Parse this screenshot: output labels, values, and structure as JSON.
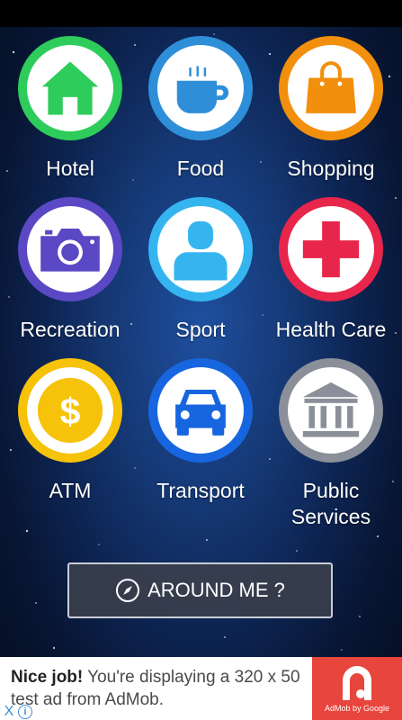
{
  "categories": [
    {
      "label": "Hotel",
      "color": "#2ecc5a",
      "icon": "house-icon"
    },
    {
      "label": "Food",
      "color": "#2e8fd8",
      "icon": "coffee-cup-icon"
    },
    {
      "label": "Shopping",
      "color": "#f28f0c",
      "icon": "shopping-bag-icon"
    },
    {
      "label": "Recreation",
      "color": "#5a48c4",
      "icon": "camera-icon"
    },
    {
      "label": "Sport",
      "color": "#35b5ef",
      "icon": "person-icon"
    },
    {
      "label": "Health Care",
      "color": "#e8254a",
      "icon": "medical-cross-icon"
    },
    {
      "label": "ATM",
      "color": "#f6c20a",
      "icon": "dollar-coin-icon"
    },
    {
      "label": "Transport",
      "color": "#1766e0",
      "icon": "car-icon"
    },
    {
      "label": "Public\nServices",
      "color": "#8a8f99",
      "icon": "bank-building-icon"
    }
  ],
  "around_button": {
    "label": "AROUND ME ?",
    "icon": "compass-icon"
  },
  "ad": {
    "headline": "Nice job!",
    "body": " You're displaying a 320 x 50 test ad from AdMob.",
    "brand": "AdMob by Google",
    "close_glyph": "X",
    "info_glyph": "i",
    "accent": "#e8453c"
  }
}
